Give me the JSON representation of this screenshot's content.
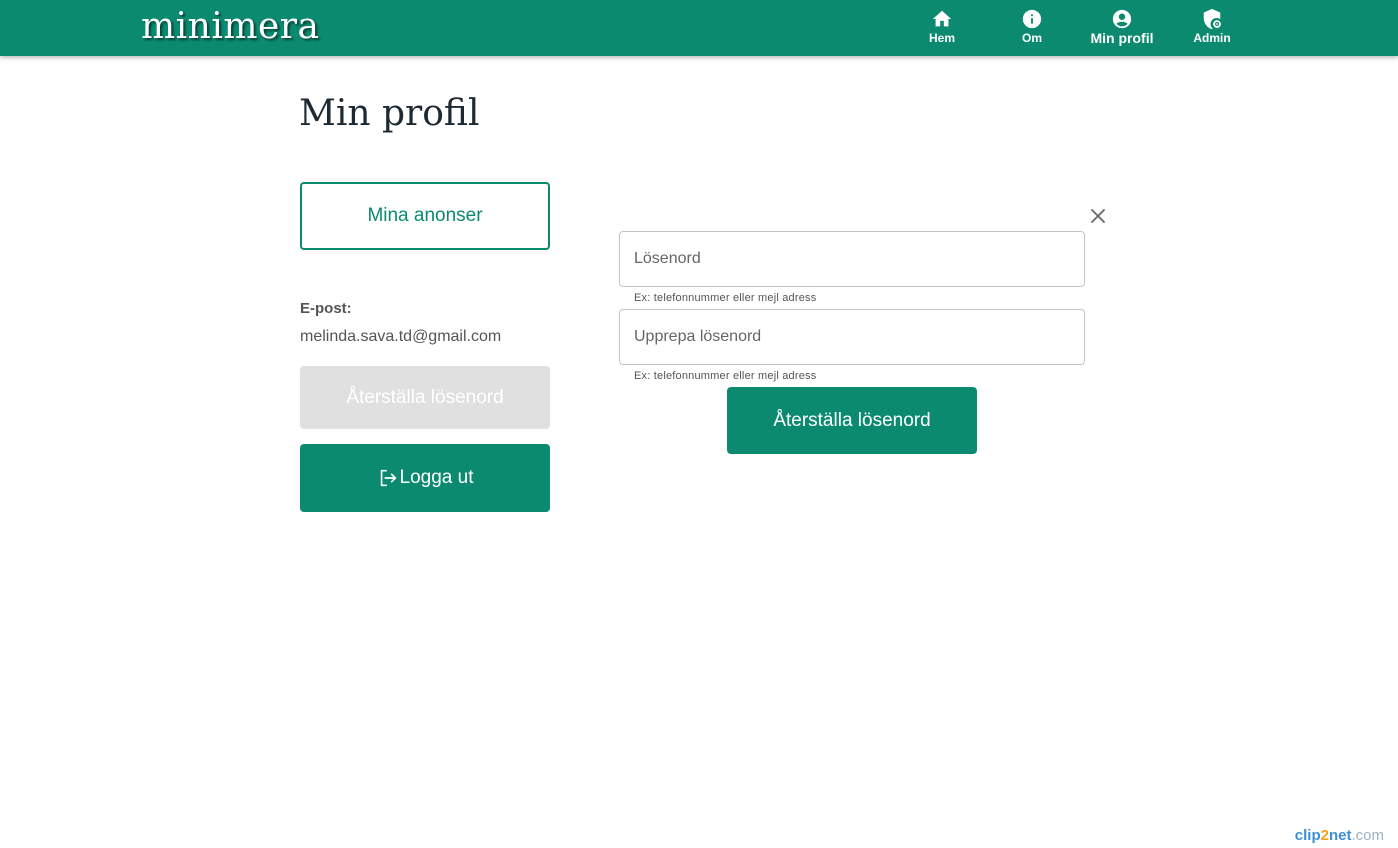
{
  "app": {
    "logo": "minimera"
  },
  "nav": {
    "items": [
      {
        "label": "Hem",
        "icon": "home-icon"
      },
      {
        "label": "Om",
        "icon": "info-icon"
      },
      {
        "label": "Min profil",
        "icon": "account-circle-icon"
      },
      {
        "label": "Admin",
        "icon": "admin-shield-icon"
      }
    ],
    "active": "Min profil"
  },
  "page": {
    "title": "Min profil"
  },
  "sidebar": {
    "my_ads_label": "Mina anonser",
    "email_label": "E-post:",
    "email_value": "melinda.sava.td@gmail.com",
    "reset_password_label": "Återställa lösenord",
    "logout_label": "Logga ut"
  },
  "reset_form": {
    "password_placeholder": "Lösenord",
    "password_helper": "Ex: telefonnummer eller mejl adress",
    "repeat_password_placeholder": "Upprepa lösenord",
    "repeat_password_helper": "Ex: telefonnummer eller mejl adress",
    "submit_label": "Återställa lösenord"
  },
  "watermark": {
    "part1": "clip",
    "part2": "2",
    "part3": "net",
    "part4": ".com"
  },
  "colors": {
    "brand": "#0b8a70",
    "disabled": "#e0e0e0"
  }
}
